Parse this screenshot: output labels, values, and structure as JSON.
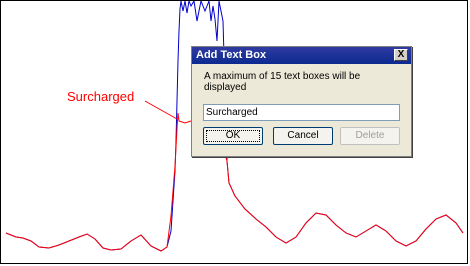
{
  "annotation": {
    "label": "Surcharged"
  },
  "dialog": {
    "title": "Add Text Box",
    "close_label": "X",
    "message": "A maximum of 15 text boxes will be displayed",
    "input_value": "Surcharged",
    "ok_label": "OK",
    "cancel_label": "Cancel",
    "delete_label": "Delete"
  },
  "chart_data": {
    "type": "line",
    "series": [
      {
        "color": "#ff0000"
      },
      {
        "color": "#0000cc"
      }
    ]
  }
}
